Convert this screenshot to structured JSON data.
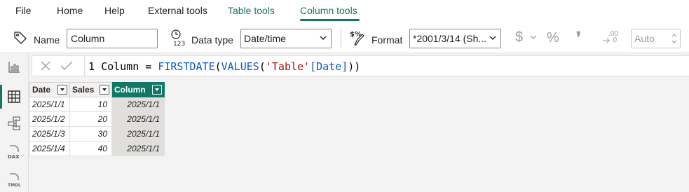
{
  "menu": {
    "tabs": [
      {
        "label": "File"
      },
      {
        "label": "Home"
      },
      {
        "label": "Help"
      },
      {
        "label": "External tools"
      },
      {
        "label": "Table tools"
      },
      {
        "label": "Column tools"
      }
    ],
    "active_tab": "Column tools"
  },
  "ribbon": {
    "name_label": "Name",
    "name_value": "Column",
    "datatype_label": "Data type",
    "datatype_value": "Date/time",
    "format_label": "Format",
    "format_value": "*2001/3/14 (Sh...",
    "currency_symbol": "$",
    "percent_symbol": "%",
    "comma_symbol": "❜",
    "decimal_top": ".00",
    "decimal_bottom": "0",
    "auto_value": "Auto"
  },
  "left_rail": {
    "items": [
      {
        "name": "report-view",
        "icon": "bar-chart-icon"
      },
      {
        "name": "table-view",
        "icon": "table-grid-icon"
      },
      {
        "name": "model-view",
        "icon": "model-icon"
      },
      {
        "name": "dax-query-view",
        "icon": "dax-icon",
        "text": "DAX"
      },
      {
        "name": "tmdl-view",
        "icon": "tmdl-icon",
        "text": "TMDL"
      }
    ],
    "active": "table-view"
  },
  "formula_bar": {
    "line_number": "1",
    "column_name": "Column",
    "equals": "=",
    "func_outer": "FIRSTDATE",
    "func_inner": "VALUES",
    "table_ref": "'Table'",
    "column_ref": "[Date]"
  },
  "table": {
    "columns": [
      {
        "label": "Date"
      },
      {
        "label": "Sales"
      },
      {
        "label": "Column",
        "selected": true
      }
    ],
    "rows": [
      [
        "2025/1/1",
        "10",
        "2025/1/1"
      ],
      [
        "2025/1/2",
        "20",
        "2025/1/1"
      ],
      [
        "2025/1/3",
        "30",
        "2025/1/1"
      ],
      [
        "2025/1/4",
        "40",
        "2025/1/1"
      ]
    ]
  },
  "colors": {
    "accent": "#117865",
    "keyword": "#035aca",
    "string": "#a31515"
  }
}
